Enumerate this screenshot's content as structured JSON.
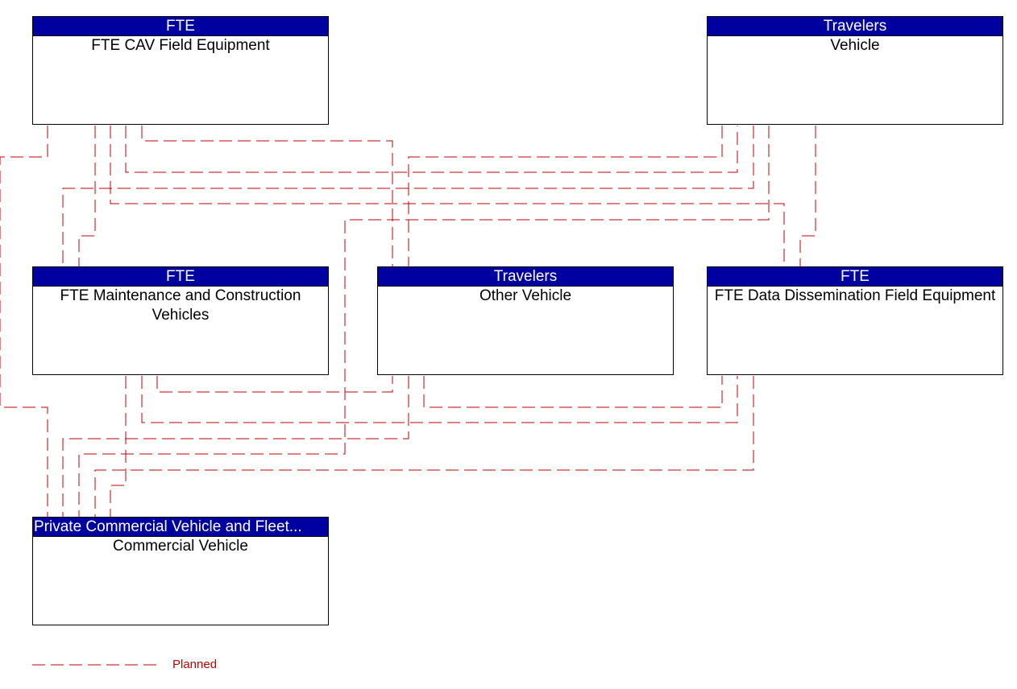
{
  "elements": [
    {
      "id": "cav",
      "group": "FTE",
      "name": "FTE CAV Field Equipment"
    },
    {
      "id": "vehicle",
      "group": "Travelers",
      "name": "Vehicle"
    },
    {
      "id": "maint",
      "group": "FTE",
      "name": "FTE Maintenance and Construction Vehicles"
    },
    {
      "id": "other",
      "group": "Travelers",
      "name": "Other Vehicle"
    },
    {
      "id": "dissem",
      "group": "FTE",
      "name": "FTE Data Dissemination Field Equipment"
    },
    {
      "id": "commercial",
      "group": "Private Commercial Vehicle and Fleet...",
      "name": "Commercial Vehicle"
    }
  ],
  "connections": [
    {
      "from": "cav",
      "to": "commercial",
      "status": "Planned"
    },
    {
      "from": "cav",
      "to": "maint",
      "status": "Planned"
    },
    {
      "from": "cav",
      "to": "dissem",
      "status": "Planned"
    },
    {
      "from": "cav",
      "to": "vehicle",
      "status": "Planned"
    },
    {
      "from": "cav",
      "to": "other",
      "status": "Planned"
    },
    {
      "from": "vehicle",
      "to": "other",
      "status": "Planned"
    },
    {
      "from": "vehicle",
      "to": "maint",
      "status": "Planned"
    },
    {
      "from": "vehicle",
      "to": "commercial",
      "status": "Planned"
    },
    {
      "from": "vehicle",
      "to": "dissem",
      "status": "Planned"
    },
    {
      "from": "maint",
      "to": "commercial",
      "status": "Planned"
    },
    {
      "from": "maint",
      "to": "dissem",
      "status": "Planned"
    },
    {
      "from": "maint",
      "to": "other",
      "status": "Planned"
    },
    {
      "from": "other",
      "to": "commercial",
      "status": "Planned"
    },
    {
      "from": "other",
      "to": "dissem",
      "status": "Planned"
    },
    {
      "from": "dissem",
      "to": "commercial",
      "status": "Planned"
    }
  ],
  "legend": {
    "label": "Planned",
    "color": "#c00000"
  },
  "colors": {
    "header": "#0000A0",
    "line": "#c00000"
  }
}
